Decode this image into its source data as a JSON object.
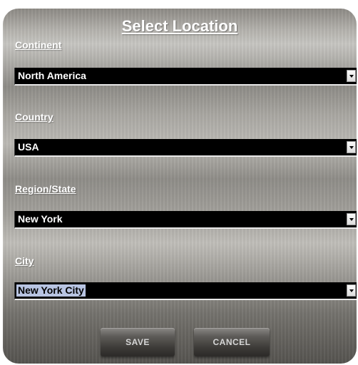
{
  "dialog": {
    "title": "Select Location",
    "save_label": "SAVE",
    "cancel_label": "CANCEL"
  },
  "fields": {
    "continent": {
      "label": "Continent",
      "value": "North America"
    },
    "country": {
      "label": "Country",
      "value": "USA"
    },
    "region": {
      "label": "Region/State",
      "value": "New York"
    },
    "city": {
      "label": "City",
      "value": "New York City"
    }
  },
  "icons": {
    "dropdown_arrow": "chevron-down-icon"
  },
  "colors": {
    "select_background": "#000000",
    "select_text": "#ffffff",
    "highlight": "#b8c4e2",
    "label_text": "#ffffff"
  }
}
